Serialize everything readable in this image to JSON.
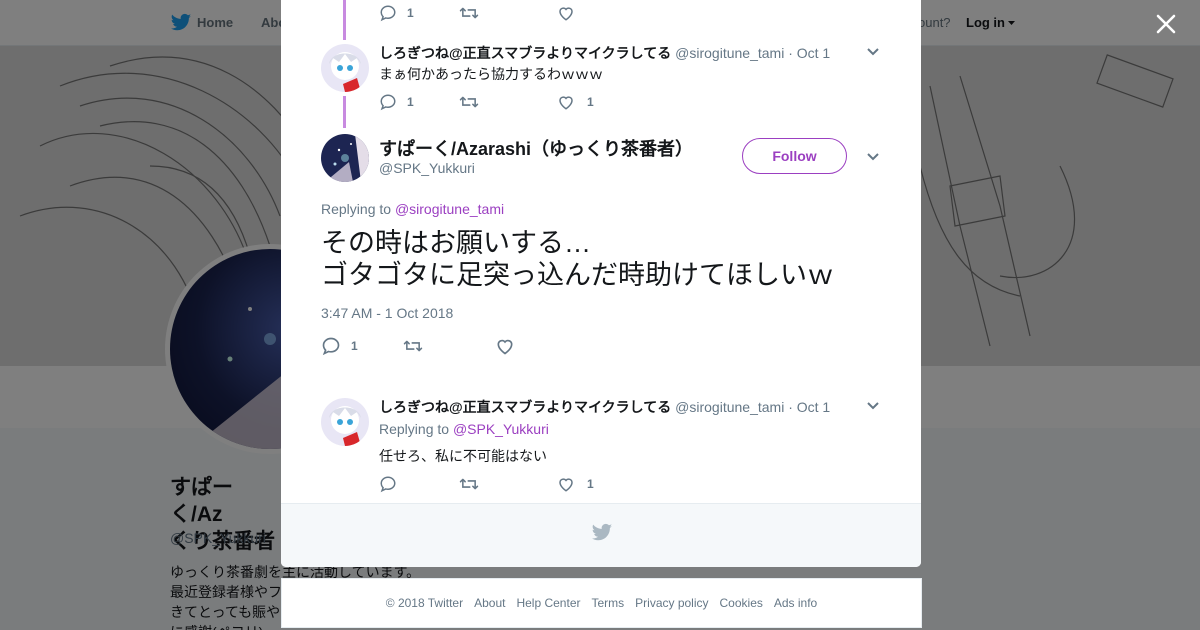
{
  "topbar": {
    "home": "Home",
    "about": "Abo",
    "account": "ccount?",
    "login": "Log in"
  },
  "profile": {
    "name": "すぱーく/Az\nくり茶番者",
    "handle": "@SPK_Yukkuri",
    "bio": "ゆっくり茶番劇を主に活動しています。\n最近登録者様やフ\nきてとっても賑やか\nに感謝(ペコリ)"
  },
  "modal": {
    "tweets": [
      {
        "reply_count": "1",
        "like_count": ""
      },
      {
        "name": "しろぎつね@正直スマブラよりマイクラしてる",
        "handle": "@sirogitune_tami",
        "time": "· Oct 1",
        "text": "まぁ何かあったら協力するわｗｗｗ",
        "reply_count": "1",
        "like_count": "1"
      }
    ],
    "main": {
      "name": "すぱーく/Azarashi（ゆっくり茶番者）",
      "handle": "@SPK_Yukkuri",
      "follow": "Follow",
      "replying_prefix": "Replying to",
      "replying_to": "@sirogitune_tami",
      "text": "その時はお願いする…\nゴタゴタに足突っ込んだ時助けてほしいｗ",
      "timestamp": "3:47 AM - 1 Oct 2018",
      "reply_count": "1"
    },
    "reply": {
      "name": "しろぎつね@正直スマブラよりマイクラしてる",
      "handle": "@sirogitune_tami",
      "time": "· Oct 1",
      "replying_prefix": "Replying to",
      "replying_to": "@SPK_Yukkuri",
      "text": "任せろ、私に不可能はない",
      "reply_count": "",
      "like_count": "1"
    }
  },
  "footer": {
    "copyright": "© 2018 Twitter",
    "links": [
      "About",
      "Help Center",
      "Terms",
      "Privacy policy",
      "Cookies",
      "Ads info"
    ]
  },
  "colors": {
    "accent": "#9b3fc1",
    "thread_line": "#c88ae0",
    "twitter_blue": "#1da1f2",
    "muted": "#657786"
  },
  "icons": [
    "twitter-bird-icon",
    "close-icon",
    "reply-icon",
    "retweet-icon",
    "like-icon",
    "chevron-down-icon",
    "caret-down-icon"
  ]
}
